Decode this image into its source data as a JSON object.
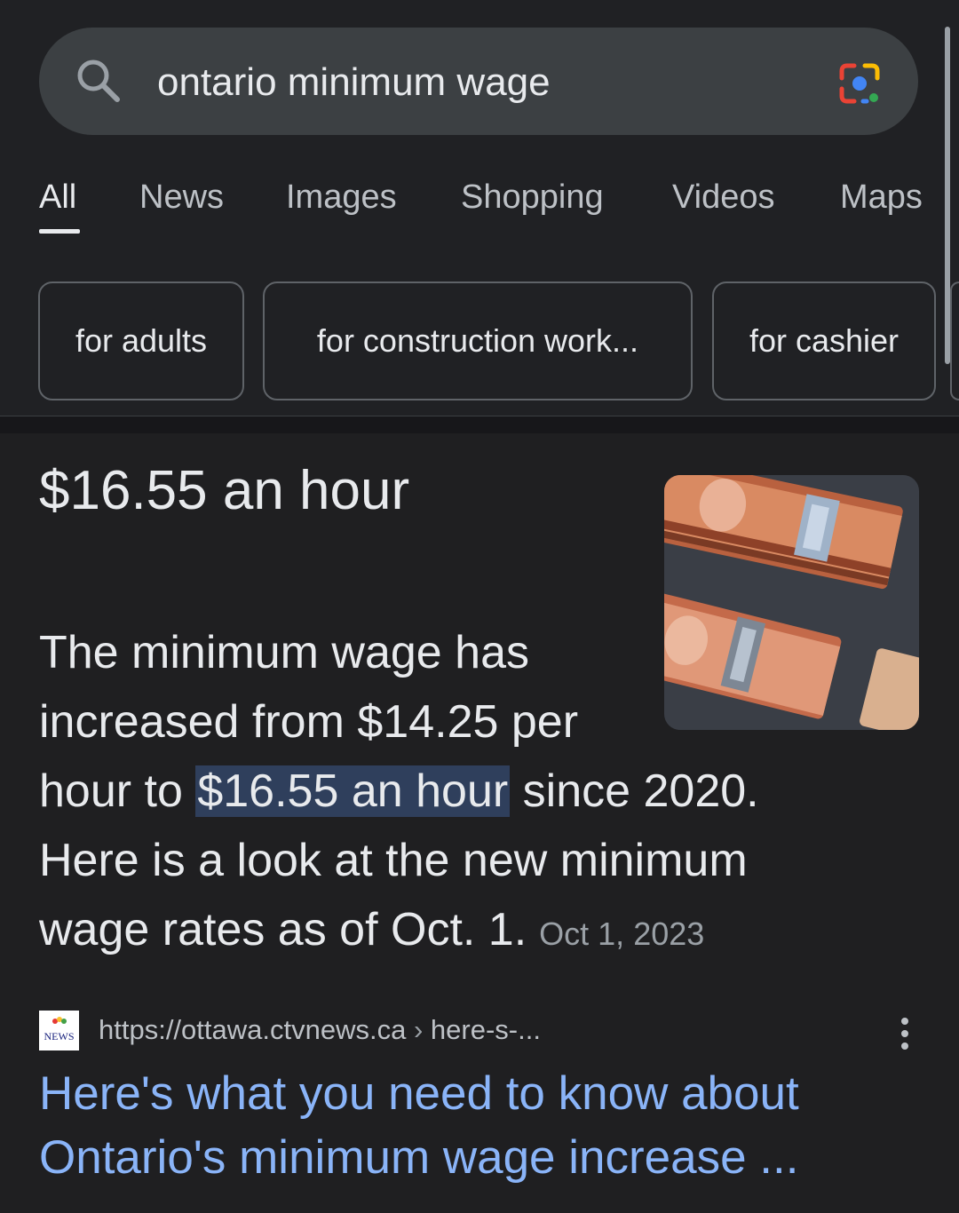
{
  "search": {
    "query": "ontario minimum wage"
  },
  "tabs": [
    {
      "label": "All",
      "active": true
    },
    {
      "label": "News"
    },
    {
      "label": "Images"
    },
    {
      "label": "Shopping"
    },
    {
      "label": "Videos"
    },
    {
      "label": "Maps"
    }
  ],
  "chips": [
    {
      "label": "for adults"
    },
    {
      "label": "for construction work..."
    },
    {
      "label": "for cashier"
    }
  ],
  "answer": {
    "headline": "$16.55 an hour",
    "snippet": {
      "line1": "The minimum wage has",
      "line2": "increased from $14.25 per",
      "line3_before": "hour to ",
      "line3_highlight": "$16.55 an hour",
      "line3_after": " since 2020.",
      "line4": "Here is a look at the new minimum",
      "line5": "wage rates as of Oct. 1."
    },
    "date": "Oct 1, 2023"
  },
  "result": {
    "favicon_text": "NEWS",
    "url_base": "https://ottawa.ctvnews.ca",
    "url_separator": "›",
    "url_path": "here-s-...",
    "title_line1": "Here's what you need to know about",
    "title_line2": "Ontario's minimum wage increase ..."
  },
  "colors": {
    "background": "#1f1f21",
    "search_bar": "#3c4043",
    "link": "#8ab4f8",
    "highlight": "#2f3f5c"
  },
  "icons": {
    "search": "search-icon",
    "lens": "google-lens-icon",
    "more": "more-vert-icon"
  }
}
